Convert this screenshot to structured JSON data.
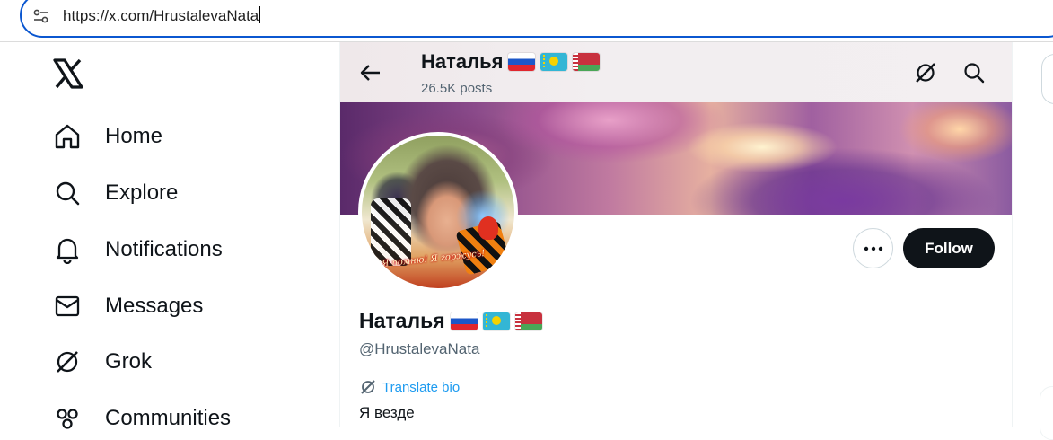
{
  "browser": {
    "url": "https://x.com/HrustalevaNata"
  },
  "sidebar": {
    "logo": "x-logo",
    "items": [
      {
        "label": "Home",
        "icon": "home-icon"
      },
      {
        "label": "Explore",
        "icon": "search-icon"
      },
      {
        "label": "Notifications",
        "icon": "bell-icon"
      },
      {
        "label": "Messages",
        "icon": "mail-icon"
      },
      {
        "label": "Grok",
        "icon": "grok-icon"
      },
      {
        "label": "Communities",
        "icon": "communities-icon"
      }
    ]
  },
  "header": {
    "name": "Наталья",
    "posts": "26.5K posts",
    "flags": [
      "russia-flag",
      "kazakhstan-flag",
      "belarus-flag"
    ]
  },
  "profile": {
    "name": "Наталья",
    "handle": "@HrustalevaNata",
    "translate_label": "Translate bio",
    "bio": "Я везде",
    "avatar_caption": "Я помню! Я горжусь!",
    "follow_label": "Follow"
  },
  "colors": {
    "accent": "#1d9bf0",
    "text": "#0f1419",
    "muted": "#536471",
    "browser_focus": "#0b57d0"
  }
}
